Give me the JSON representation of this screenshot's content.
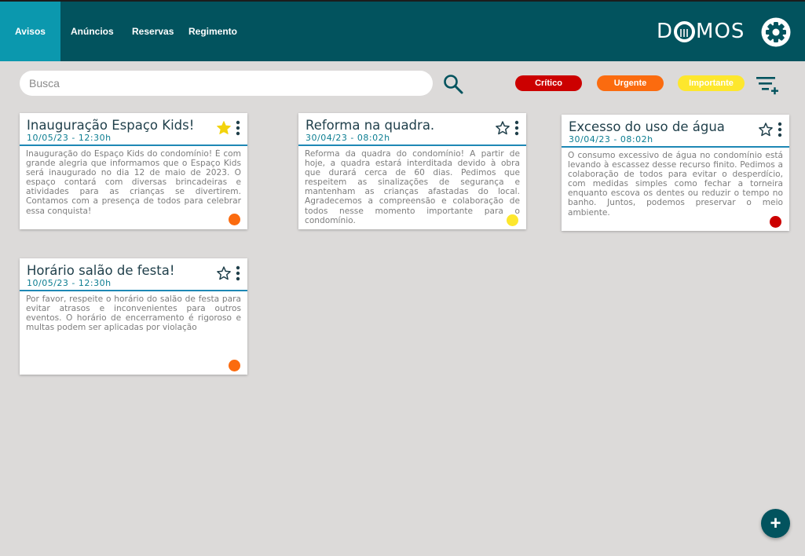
{
  "nav": {
    "tabs": [
      {
        "label": "Avisos",
        "active": true
      },
      {
        "label": "Anúncios"
      },
      {
        "label": "Reservas"
      },
      {
        "label": "Regimento"
      }
    ],
    "logo": {
      "part1": "D",
      "part2": "MOS"
    },
    "settings_icon": "gear-icon"
  },
  "search": {
    "placeholder": "Busca",
    "icon": "search-icon"
  },
  "filters": {
    "chips": [
      {
        "label": "Crítico",
        "color": "#cc0000"
      },
      {
        "label": "Urgente",
        "color": "#fb6b0f"
      },
      {
        "label": "Importante",
        "color": "#fde72d"
      }
    ],
    "filter_icon": "filter-add-icon"
  },
  "cards": [
    {
      "title": "Inauguração Espaço Kids!",
      "date": "10/05/23 - 12:30h",
      "body": "Inauguração do Espaço Kids do condomínio! É com grande alegria que informamos que o Espaço Kids será inaugurado no dia 12 de maio de 2023. O espaço contará com diversas brincadeiras e atividades para as crianças se divertirem. Contamos com a presença de todos para celebrar essa conquista!",
      "starred": true,
      "priority_color": "#fb6b0f"
    },
    {
      "title": "Reforma na quadra.",
      "date": "30/04/23 - 08:02h",
      "body": "Reforma da quadra do condomínio! A partir de hoje, a quadra estará interditada devido à obra que durará cerca de 60 dias. Pedimos que respeitem as sinalizações de segurança e mantenham as crianças afastadas do local. Agradecemos a compreensão e colaboração de todos nesse momento importante para o condomínio.",
      "starred": false,
      "priority_color": "#fde72d"
    },
    {
      "title": "Excesso do uso de água",
      "date": "30/04/23 - 08:02h",
      "body": "O consumo excessivo de água no condomínio está levando à escassez desse recurso finito. Pedimos a colaboração de todos para evitar o desperdício, com medidas simples como fechar a torneira enquanto escova os dentes ou reduzir o tempo no banho. Juntos, podemos preservar o meio ambiente.",
      "starred": false,
      "priority_color": "#cc0000"
    },
    {
      "title": "Horário salão de festa!",
      "date": "10/05/23 - 12:30h",
      "body": "Por favor, respeite o horário do salão de festa para evitar atrasos e inconvenientes para outros eventos. O horário de encerramento é rigoroso e multas podem ser aplicadas por violação",
      "starred": false,
      "priority_color": "#fb6b0f"
    }
  ],
  "fab": {
    "label": "+"
  }
}
